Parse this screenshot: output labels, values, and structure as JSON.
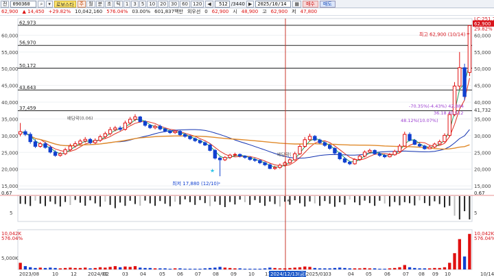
{
  "toolbar": {
    "menu_label": "전",
    "code": "090360",
    "stock_name": "로보스타",
    "view_buttons": [
      "주",
      "월",
      "분",
      "초",
      "틱",
      "1",
      "3",
      "5",
      "10",
      "20",
      "30",
      "60",
      "120"
    ],
    "count": "512",
    "total": "3440",
    "date": "2025/10/14",
    "buy_label": "매수",
    "sell_label": "매도"
  },
  "quote": {
    "price": "62,900",
    "change": "▲ 14,450",
    "change_pct": "+29.82%",
    "volume": "10,042,160",
    "volume_pct": "576.04%",
    "rate": "03.00%",
    "amount": "601,837백만",
    "prefer_label": "외우선",
    "prefer_value": "0",
    "cur": "62,900",
    "open_label": "시",
    "open": "48,900",
    "high_label": "고",
    "high": "62,900",
    "low_label": "저",
    "low": "47,800"
  },
  "colors": {
    "up": "#e01010",
    "down": "#1040d0",
    "ma_red": "#e03020",
    "ma_blue": "#1030b0",
    "ma_orange": "#e08a2a",
    "ma_green": "#20a060",
    "ma_purple": "#9a3cd0",
    "cursor": "#c8382e"
  },
  "icons": {
    "cursor": "arrow-cursor-icon",
    "star": "star-icon"
  },
  "chart_data": {
    "type": "candlestick",
    "x_labels": [
      "2023/08",
      "10",
      "12",
      "2024/01",
      "02",
      "03",
      "04",
      "05",
      "06",
      "07",
      "08",
      "09",
      "10",
      "11",
      "12",
      "2024/12/13(금)",
      "2025/01",
      "03",
      "04",
      "05",
      "06",
      "07",
      "08",
      "09",
      "10",
      "10/14"
    ],
    "y_ticks": [
      "60,000",
      "55,000",
      "50,000",
      "45,000",
      "40,000",
      "35,000",
      "30,000",
      "25,000",
      "20,000",
      "15,000"
    ],
    "ylim": [
      14000,
      65000
    ],
    "hlines": [
      {
        "label": "62,973",
        "value": 62973
      },
      {
        "label": "56,970",
        "value": 56970
      },
      {
        "label": "50,172",
        "value": 50172
      },
      {
        "label": "43,643",
        "value": 43643
      },
      {
        "label": "37,459",
        "value": 37459
      }
    ],
    "right_labels": [
      {
        "text": "LC:251.79",
        "value": 64800
      },
      {
        "text": "62,900",
        "value": 63400
      },
      {
        "text": "29.82%",
        "value": 61800
      },
      {
        "text": "41,732",
        "value": 37600
      }
    ],
    "annotations": [
      {
        "text": "최고 62,900 (10/14)",
        "kind": "high"
      },
      {
        "text": "최저 17,880 (12/10)",
        "kind": "low"
      },
      {
        "text": "-70.35%(-4.43%) 42,884",
        "kind": "range"
      },
      {
        "text": "48.12%(10.07%)",
        "kind": "range2"
      },
      {
        "text": "36.18 40,512",
        "kind": "range3"
      },
      {
        "text": "배당락(0.06)",
        "kind": "ex1"
      },
      {
        "text": "배당락(",
        "kind": "ex2"
      }
    ],
    "closes": [
      31200,
      30400,
      28200,
      26800,
      27600,
      26500,
      25100,
      24100,
      24600,
      25800,
      26900,
      27600,
      28400,
      28900,
      27900,
      28600,
      29700,
      30600,
      31800,
      32300,
      31900,
      33800,
      34900,
      35600,
      34200,
      33100,
      32400,
      32800,
      32000,
      31400,
      30900,
      31300,
      30300,
      29800,
      29100,
      28500,
      27900,
      27200,
      25600,
      23300,
      22800,
      23500,
      24200,
      24400,
      23900,
      23500,
      22900,
      22600,
      21900,
      21300,
      20200,
      20500,
      21200,
      21900,
      22800,
      24600,
      26800,
      28800,
      29800,
      28700,
      27900,
      27100,
      26200,
      24800,
      23100,
      22100,
      21600,
      22900,
      23900,
      25100,
      25600,
      24600,
      24100,
      23700,
      24300,
      25300,
      26900,
      30400,
      28600,
      27400,
      26900,
      26100,
      26600,
      27500,
      28200,
      30100,
      36300,
      44800,
      50300,
      41700,
      62900
    ],
    "opens": [
      30500,
      31200,
      30400,
      28200,
      26800,
      27600,
      26500,
      25100,
      24100,
      24600,
      25800,
      26900,
      27600,
      28400,
      28900,
      27900,
      28600,
      29700,
      30600,
      31800,
      32300,
      31900,
      33800,
      34900,
      35600,
      34200,
      33100,
      32400,
      32800,
      32000,
      31400,
      30900,
      31300,
      30300,
      29800,
      29100,
      28500,
      27900,
      27200,
      25600,
      23300,
      22800,
      23500,
      24200,
      24400,
      23900,
      23500,
      22900,
      22600,
      21900,
      21300,
      20200,
      20500,
      21200,
      21900,
      22800,
      24600,
      26800,
      28800,
      29800,
      28700,
      27900,
      27100,
      26200,
      24800,
      23100,
      22100,
      21600,
      22900,
      23900,
      25100,
      25600,
      24600,
      24100,
      23700,
      24300,
      25300,
      26900,
      30400,
      28600,
      27400,
      26900,
      26100,
      26600,
      27500,
      28200,
      30100,
      36300,
      44800,
      50300,
      48900
    ],
    "highs": [
      33800,
      31800,
      31000,
      28900,
      28100,
      28200,
      27100,
      25600,
      25100,
      26400,
      27600,
      28300,
      29000,
      29600,
      29300,
      29200,
      30300,
      31200,
      32600,
      32900,
      32900,
      34500,
      35600,
      36400,
      35900,
      34600,
      33500,
      33300,
      33300,
      32400,
      31900,
      31800,
      31700,
      30800,
      30200,
      29500,
      28900,
      28300,
      27700,
      26000,
      23800,
      23900,
      24600,
      24900,
      24700,
      24200,
      23900,
      23400,
      23000,
      22300,
      21700,
      21000,
      21700,
      22400,
      23300,
      25200,
      27400,
      29600,
      30600,
      30200,
      29100,
      28300,
      27600,
      26600,
      25200,
      23600,
      22500,
      23300,
      24400,
      25600,
      26100,
      25900,
      25000,
      24500,
      24800,
      25800,
      27500,
      31200,
      31000,
      29000,
      27800,
      27300,
      27100,
      27900,
      28800,
      30700,
      37200,
      46000,
      55000,
      51500,
      62900
    ],
    "lows": [
      29800,
      29900,
      27600,
      26300,
      26400,
      26100,
      24700,
      23700,
      23700,
      24200,
      25400,
      26400,
      27100,
      27900,
      27500,
      27500,
      28100,
      29200,
      30100,
      31300,
      31400,
      31500,
      33300,
      34300,
      33900,
      32700,
      32000,
      31900,
      31600,
      31000,
      30500,
      30500,
      29900,
      29400,
      28700,
      28100,
      27500,
      26900,
      25300,
      22900,
      17880,
      22400,
      23000,
      23800,
      23500,
      23100,
      22500,
      22200,
      21500,
      20900,
      20000,
      19800,
      20100,
      20800,
      21600,
      22500,
      24200,
      26400,
      28300,
      28300,
      27500,
      26700,
      25800,
      24400,
      22700,
      21800,
      21200,
      21300,
      22500,
      23500,
      24800,
      24300,
      23700,
      23300,
      23500,
      24000,
      25000,
      26700,
      28300,
      27200,
      26600,
      25800,
      26000,
      26300,
      27300,
      28000,
      29700,
      35800,
      43800,
      40600,
      47800
    ],
    "volumes": [
      0.18,
      0.09,
      0.06,
      0.04,
      0.05,
      0.04,
      0.05,
      0.04,
      0.03,
      0.04,
      0.05,
      0.04,
      0.04,
      0.05,
      0.03,
      0.04,
      0.06,
      0.05,
      0.07,
      0.09,
      0.06,
      0.08,
      0.07,
      0.09,
      0.05,
      0.04,
      0.04,
      0.03,
      0.03,
      0.03,
      0.02,
      0.03,
      0.03,
      0.02,
      0.02,
      0.02,
      0.02,
      0.03,
      0.04,
      0.05,
      0.07,
      0.05,
      0.04,
      0.03,
      0.03,
      0.02,
      0.02,
      0.02,
      0.02,
      0.03,
      0.05,
      0.04,
      0.03,
      0.03,
      0.04,
      0.05,
      0.06,
      0.08,
      0.07,
      0.04,
      0.03,
      0.03,
      0.03,
      0.04,
      0.05,
      0.04,
      0.03,
      0.03,
      0.03,
      0.04,
      0.03,
      0.03,
      0.02,
      0.02,
      0.03,
      0.04,
      0.06,
      0.12,
      0.06,
      0.04,
      0.03,
      0.03,
      0.03,
      0.04,
      0.04,
      0.06,
      0.18,
      0.44,
      0.82,
      0.35,
      0.96
    ],
    "volume_labels": {
      "left_top": "10,042K",
      "left_pct": "576.04%",
      "left_mid": "5,000K",
      "right_top": "10,042K",
      "right_pct": "576.04%"
    },
    "indicator_labels": {
      "left": "0.67",
      "right": "0.67",
      "left_mid": "5",
      "right_mid": "5"
    }
  }
}
